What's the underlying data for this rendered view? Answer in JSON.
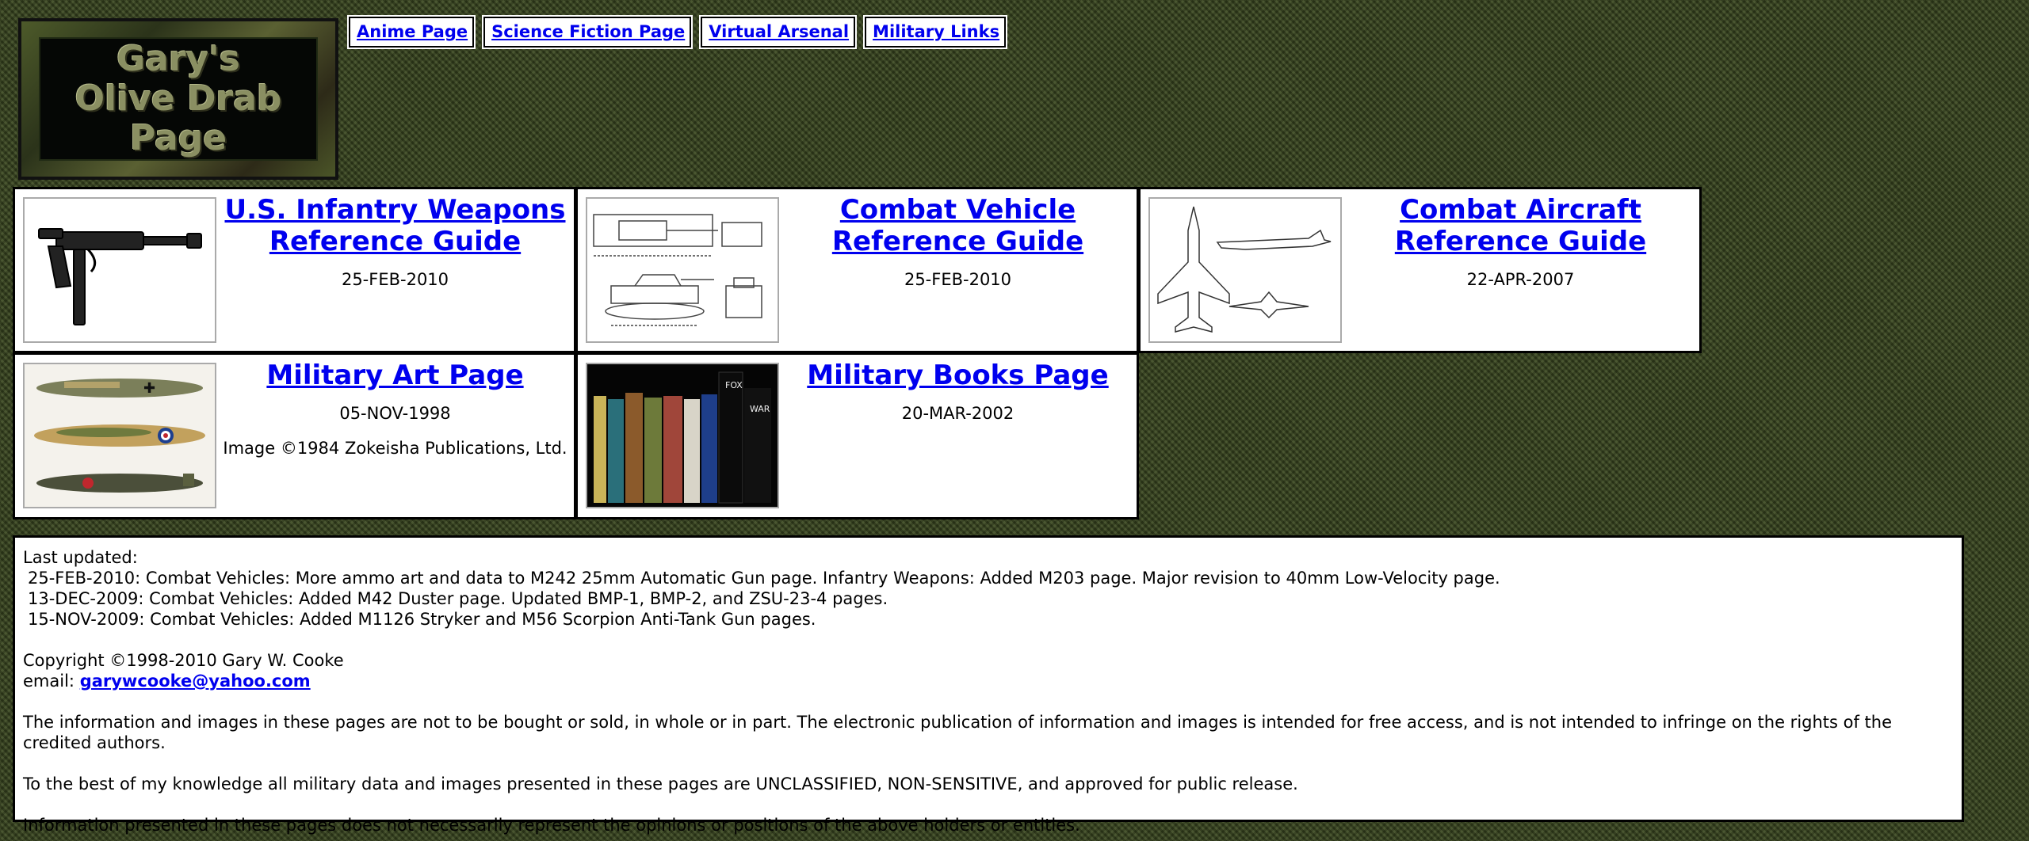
{
  "logo": {
    "text": "Gary's\nOlive Drab\nPage"
  },
  "nav": [
    {
      "label": "Anime Page"
    },
    {
      "label": "Science Fiction Page"
    },
    {
      "label": "Virtual Arsenal"
    },
    {
      "label": "Military Links"
    }
  ],
  "cards": [
    {
      "title": "U.S. Infantry Weapons Reference Guide",
      "date": "25-FEB-2010"
    },
    {
      "title": "Combat Vehicle Reference Guide",
      "date": "25-FEB-2010"
    },
    {
      "title": "Combat Aircraft Reference Guide",
      "date": "22-APR-2007"
    },
    {
      "title": "Military Art Page",
      "date": "05-NOV-1998",
      "credit": "Image ©1984 Zokeisha Publications, Ltd."
    },
    {
      "title": "Military Books Page",
      "date": "20-MAR-2002"
    }
  ],
  "info": {
    "last_updated_label": "Last updated:",
    "updates": [
      "25-FEB-2010: Combat Vehicles: More ammo art and data to M242 25mm Automatic Gun page. Infantry Weapons: Added M203 page. Major revision to 40mm Low-Velocity page.",
      "13-DEC-2009: Combat Vehicles: Added M42 Duster page. Updated BMP-1, BMP-2, and ZSU-23-4 pages.",
      "15-NOV-2009: Combat Vehicles: Added M1126 Stryker and M56 Scorpion Anti-Tank Gun pages."
    ],
    "copyright": "Copyright ©1998-2010 Gary W. Cooke",
    "email_label": "email:",
    "email": "garywcooke@yahoo.com",
    "disclaimer1": "The information and images in these pages are not to be bought or sold, in whole or in part. The electronic publication of information and images is intended for free access, and is not intended to infringe on the rights of the credited authors.",
    "disclaimer2": "To the best of my knowledge all military data and images presented in these pages are UNCLASSIFIED, NON-SENSITIVE, and approved for public release.",
    "disclaimer3": "Information presented in these pages does not necessarily represent the opinions or positions of the above holders or entities."
  },
  "colors": {
    "background": "#3d4a22",
    "link": "#0000ee"
  }
}
